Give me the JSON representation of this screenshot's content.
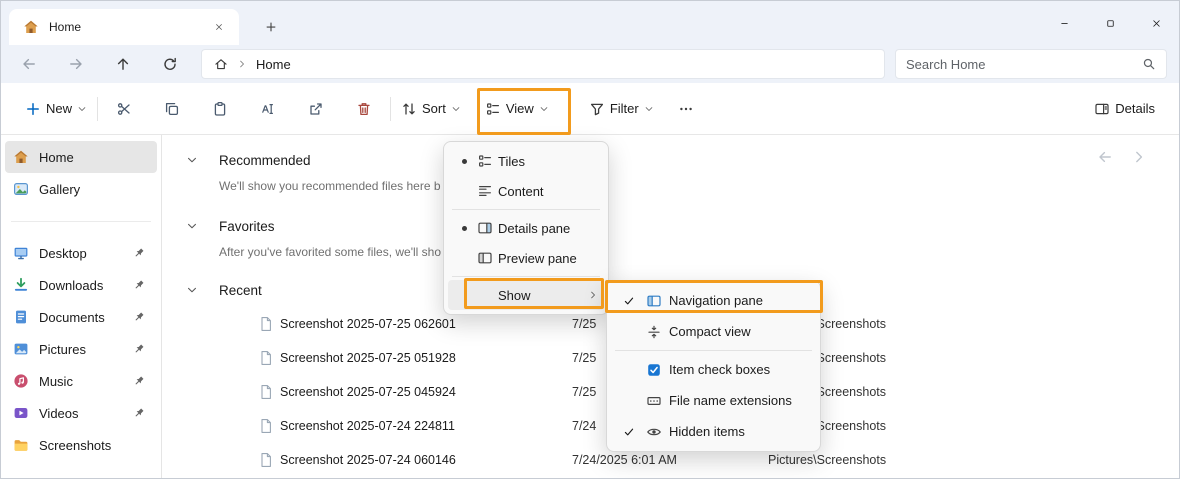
{
  "colors": {
    "accent_orange": "#F29B1D",
    "accent_blue": "#0067c0"
  },
  "titlebar": {
    "tab_title": "Home"
  },
  "navbar": {
    "breadcrumb_item": "Home",
    "search_placeholder": "Search Home"
  },
  "toolbar": {
    "new": "New",
    "sort": "Sort",
    "view": "View",
    "filter": "Filter",
    "details": "Details"
  },
  "sidebar": {
    "items": [
      {
        "label": "Home"
      },
      {
        "label": "Gallery"
      },
      {
        "label": "Desktop",
        "pinned": true
      },
      {
        "label": "Downloads",
        "pinned": true
      },
      {
        "label": "Documents",
        "pinned": true
      },
      {
        "label": "Pictures",
        "pinned": true
      },
      {
        "label": "Music",
        "pinned": true
      },
      {
        "label": "Videos",
        "pinned": true
      },
      {
        "label": "Screenshots",
        "pinned": false
      }
    ]
  },
  "content": {
    "sections": {
      "recommended": {
        "title": "Recommended",
        "hint": "We'll show you recommended files here b"
      },
      "favorites": {
        "title": "Favorites",
        "hint": "After you've favorited some files, we'll sho"
      },
      "recent": {
        "title": "Recent"
      }
    },
    "files": [
      {
        "name": "Screenshot 2025-07-25 062601",
        "date": "7/25",
        "path": "Screenshots"
      },
      {
        "name": "Screenshot 2025-07-25 051928",
        "date": "7/25",
        "path": "Screenshots"
      },
      {
        "name": "Screenshot 2025-07-25 045924",
        "date": "7/25",
        "path": "Screenshots"
      },
      {
        "name": "Screenshot 2025-07-24 224811",
        "date": "7/24",
        "path": "Screenshots"
      },
      {
        "name": "Screenshot 2025-07-24 060146",
        "date": "7/24/2025 6:01 AM",
        "path": "Pictures\\Screenshots"
      }
    ]
  },
  "view_menu": {
    "items": [
      {
        "label": "Tiles",
        "selected": true
      },
      {
        "label": "Content",
        "selected": false
      },
      {
        "label": "Details pane",
        "selected": true
      },
      {
        "label": "Preview pane",
        "selected": false
      },
      {
        "label": "Show",
        "has_submenu": true
      }
    ]
  },
  "show_menu": {
    "items": [
      {
        "label": "Navigation pane",
        "checked": true
      },
      {
        "label": "Compact view",
        "checked": false
      },
      {
        "label": "Item check boxes",
        "checked": false
      },
      {
        "label": "File name extensions",
        "checked": false
      },
      {
        "label": "Hidden items",
        "checked": true
      }
    ]
  }
}
